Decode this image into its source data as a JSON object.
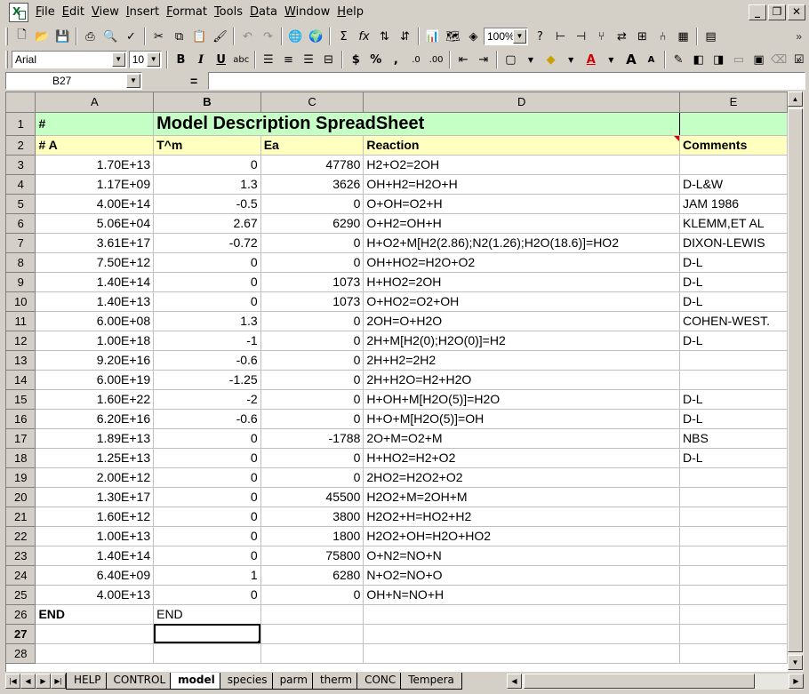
{
  "menus": [
    "File",
    "Edit",
    "View",
    "Insert",
    "Format",
    "Tools",
    "Data",
    "Window",
    "Help"
  ],
  "window_controls": [
    "_",
    "❐",
    "✕"
  ],
  "toolbar": {
    "zoom": "100%",
    "font_name": "Arial",
    "font_size": "10",
    "bold": "B",
    "italic": "I",
    "underline": "U",
    "currency": "$",
    "percent": "%",
    "comma": ",",
    "sum": "Σ",
    "fx": "fx"
  },
  "formula_bar": {
    "name_box": "B27",
    "equals": "=",
    "value": ""
  },
  "columns": [
    "A",
    "B",
    "C",
    "D",
    "E"
  ],
  "active_cell": {
    "col": "B",
    "row": 27
  },
  "title_row": {
    "marker": "#",
    "title": "Model Description SpreadSheet"
  },
  "header_row": {
    "a": "# A",
    "b": "T^m",
    "c": "Ea",
    "d": "Reaction",
    "e": "Comments"
  },
  "rows": [
    {
      "n": 3,
      "a": "1.70E+13",
      "b": "0",
      "c": "47780",
      "d": "H2+O2=2OH",
      "e": ""
    },
    {
      "n": 4,
      "a": "1.17E+09",
      "b": "1.3",
      "c": "3626",
      "d": "OH+H2=H2O+H",
      "e": "D-L&W"
    },
    {
      "n": 5,
      "a": "4.00E+14",
      "b": "-0.5",
      "c": "0",
      "d": "O+OH=O2+H",
      "e": "JAM 1986"
    },
    {
      "n": 6,
      "a": "5.06E+04",
      "b": "2.67",
      "c": "6290",
      "d": "O+H2=OH+H",
      "e": "KLEMM,ET AL"
    },
    {
      "n": 7,
      "a": "3.61E+17",
      "b": "-0.72",
      "c": "0",
      "d": "H+O2+M[H2(2.86);N2(1.26);H2O(18.6)]=HO2",
      "e": "DIXON-LEWIS"
    },
    {
      "n": 8,
      "a": "7.50E+12",
      "b": "0",
      "c": "0",
      "d": "OH+HO2=H2O+O2",
      "e": "D-L"
    },
    {
      "n": 9,
      "a": "1.40E+14",
      "b": "0",
      "c": "1073",
      "d": "H+HO2=2OH",
      "e": "D-L"
    },
    {
      "n": 10,
      "a": "1.40E+13",
      "b": "0",
      "c": "1073",
      "d": "O+HO2=O2+OH",
      "e": "D-L"
    },
    {
      "n": 11,
      "a": "6.00E+08",
      "b": "1.3",
      "c": "0",
      "d": "2OH=O+H2O",
      "e": "COHEN-WEST."
    },
    {
      "n": 12,
      "a": "1.00E+18",
      "b": "-1",
      "c": "0",
      "d": "2H+M[H2(0);H2O(0)]=H2",
      "e": "D-L"
    },
    {
      "n": 13,
      "a": "9.20E+16",
      "b": "-0.6",
      "c": "0",
      "d": "2H+H2=2H2",
      "e": ""
    },
    {
      "n": 14,
      "a": "6.00E+19",
      "b": "-1.25",
      "c": "0",
      "d": "2H+H2O=H2+H2O",
      "e": ""
    },
    {
      "n": 15,
      "a": "1.60E+22",
      "b": "-2",
      "c": "0",
      "d": "H+OH+M[H2O(5)]=H2O",
      "e": "D-L"
    },
    {
      "n": 16,
      "a": "6.20E+16",
      "b": "-0.6",
      "c": "0",
      "d": "H+O+M[H2O(5)]=OH",
      "e": "D-L"
    },
    {
      "n": 17,
      "a": "1.89E+13",
      "b": "0",
      "c": "-1788",
      "d": "2O+M=O2+M",
      "e": "NBS"
    },
    {
      "n": 18,
      "a": "1.25E+13",
      "b": "0",
      "c": "0",
      "d": "H+HO2=H2+O2",
      "e": "D-L"
    },
    {
      "n": 19,
      "a": "2.00E+12",
      "b": "0",
      "c": "0",
      "d": "2HO2=H2O2+O2",
      "e": ""
    },
    {
      "n": 20,
      "a": "1.30E+17",
      "b": "0",
      "c": "45500",
      "d": "H2O2+M=2OH+M",
      "e": ""
    },
    {
      "n": 21,
      "a": "1.60E+12",
      "b": "0",
      "c": "3800",
      "d": "H2O2+H=HO2+H2",
      "e": ""
    },
    {
      "n": 22,
      "a": "1.00E+13",
      "b": "0",
      "c": "1800",
      "d": "H2O2+OH=H2O+HO2",
      "e": ""
    },
    {
      "n": 23,
      "a": "1.40E+14",
      "b": "0",
      "c": "75800",
      "d": "O+N2=NO+N",
      "e": ""
    },
    {
      "n": 24,
      "a": "6.40E+09",
      "b": "1",
      "c": "6280",
      "d": "N+O2=NO+O",
      "e": ""
    },
    {
      "n": 25,
      "a": "4.00E+13",
      "b": "0",
      "c": "0",
      "d": "OH+N=NO+H",
      "e": ""
    }
  ],
  "end_row": {
    "n": 26,
    "a": "END",
    "b": "END"
  },
  "blank_rows": [
    27,
    28
  ],
  "row_numbers": {
    "title": 1,
    "header": 2
  },
  "sheet_tabs": [
    "HELP",
    "CONTROL",
    "model",
    "species",
    "parm",
    "therm",
    "CONC",
    "Tempera"
  ],
  "active_tab": "model"
}
